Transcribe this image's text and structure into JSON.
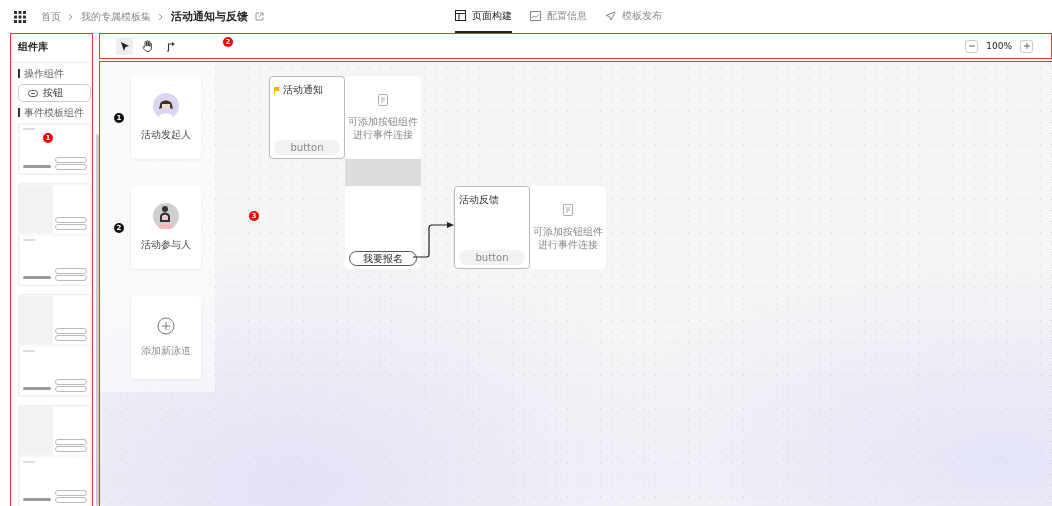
{
  "breadcrumb": [
    {
      "label": "首页",
      "selected": false
    },
    {
      "label": "我的专属模板集",
      "selected": false
    },
    {
      "label": "活动通知与反馈",
      "selected": true
    }
  ],
  "tabs": [
    {
      "label": "页面构建",
      "kind": "layout",
      "selected": true
    },
    {
      "label": "配置信息",
      "kind": "config",
      "selected": false
    },
    {
      "label": "模板发布",
      "kind": "publish",
      "selected": false
    }
  ],
  "sidebar": {
    "title": "组件库",
    "sections": [
      {
        "title": "操作组件",
        "items": [
          {
            "label": "按钮"
          }
        ]
      },
      {
        "title": "事件模板组件"
      }
    ]
  },
  "toolbar": {
    "tools": [
      {
        "kind": "pointer",
        "selected": true
      },
      {
        "kind": "hand",
        "selected": false
      },
      {
        "kind": "connector",
        "selected": false
      }
    ],
    "zoom": "100%"
  },
  "lanes": [
    {
      "number": "1",
      "name": "活动发起人",
      "kind": "organizer",
      "nodes": [
        {
          "title": "活动通知",
          "flagged": true,
          "button": {
            "label": "button",
            "active": false
          },
          "placeholder": [
            "可添加按钮组件",
            "进行事件连接"
          ]
        }
      ]
    },
    {
      "number": "2",
      "name": "活动参与人",
      "kind": "participant",
      "nodes": [
        {
          "button": {
            "label": "我要报名",
            "active": true
          }
        },
        {
          "title": "活动反馈",
          "button": {
            "label": "button",
            "active": false
          },
          "placeholder": [
            "可添加按钮组件",
            "进行事件连接"
          ]
        }
      ]
    }
  ],
  "add_lane": "添加新泳道",
  "annotations": [
    {
      "label": "1"
    },
    {
      "label": "2"
    },
    {
      "label": "3"
    }
  ]
}
